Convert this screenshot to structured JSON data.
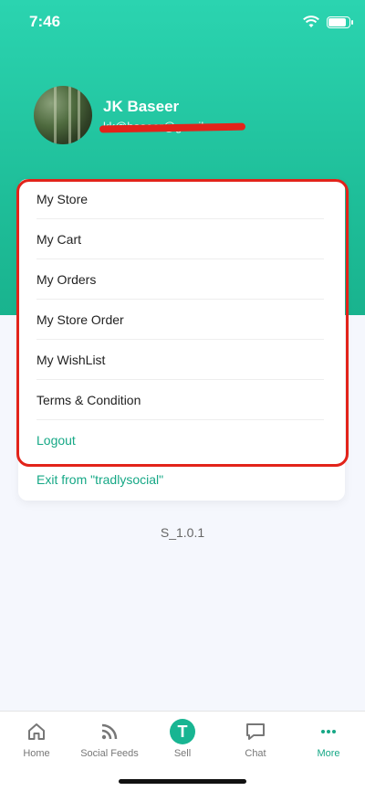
{
  "status_bar": {
    "time": "7:46"
  },
  "profile": {
    "name": "JK Baseer",
    "email": "kk@baseer@gmail.com"
  },
  "menu": {
    "items": [
      "My Store",
      "My Cart",
      "My Orders",
      "My Store Order",
      "My WishList",
      "Terms & Condition"
    ],
    "logout": "Logout",
    "exit": "Exit from \"tradlysocial\""
  },
  "version": "S_1.0.1",
  "tabbar": {
    "tabs": [
      {
        "label": "Home",
        "icon": "home-icon"
      },
      {
        "label": "Social Feeds",
        "icon": "rss-icon"
      },
      {
        "label": "Sell",
        "icon": "sell-icon"
      },
      {
        "label": "Chat",
        "icon": "chat-icon"
      },
      {
        "label": "More",
        "icon": "more-icon"
      }
    ],
    "active": "More"
  },
  "colors": {
    "accent": "#16a886",
    "header": "#1fbf9a",
    "highlight": "#e2231a"
  }
}
